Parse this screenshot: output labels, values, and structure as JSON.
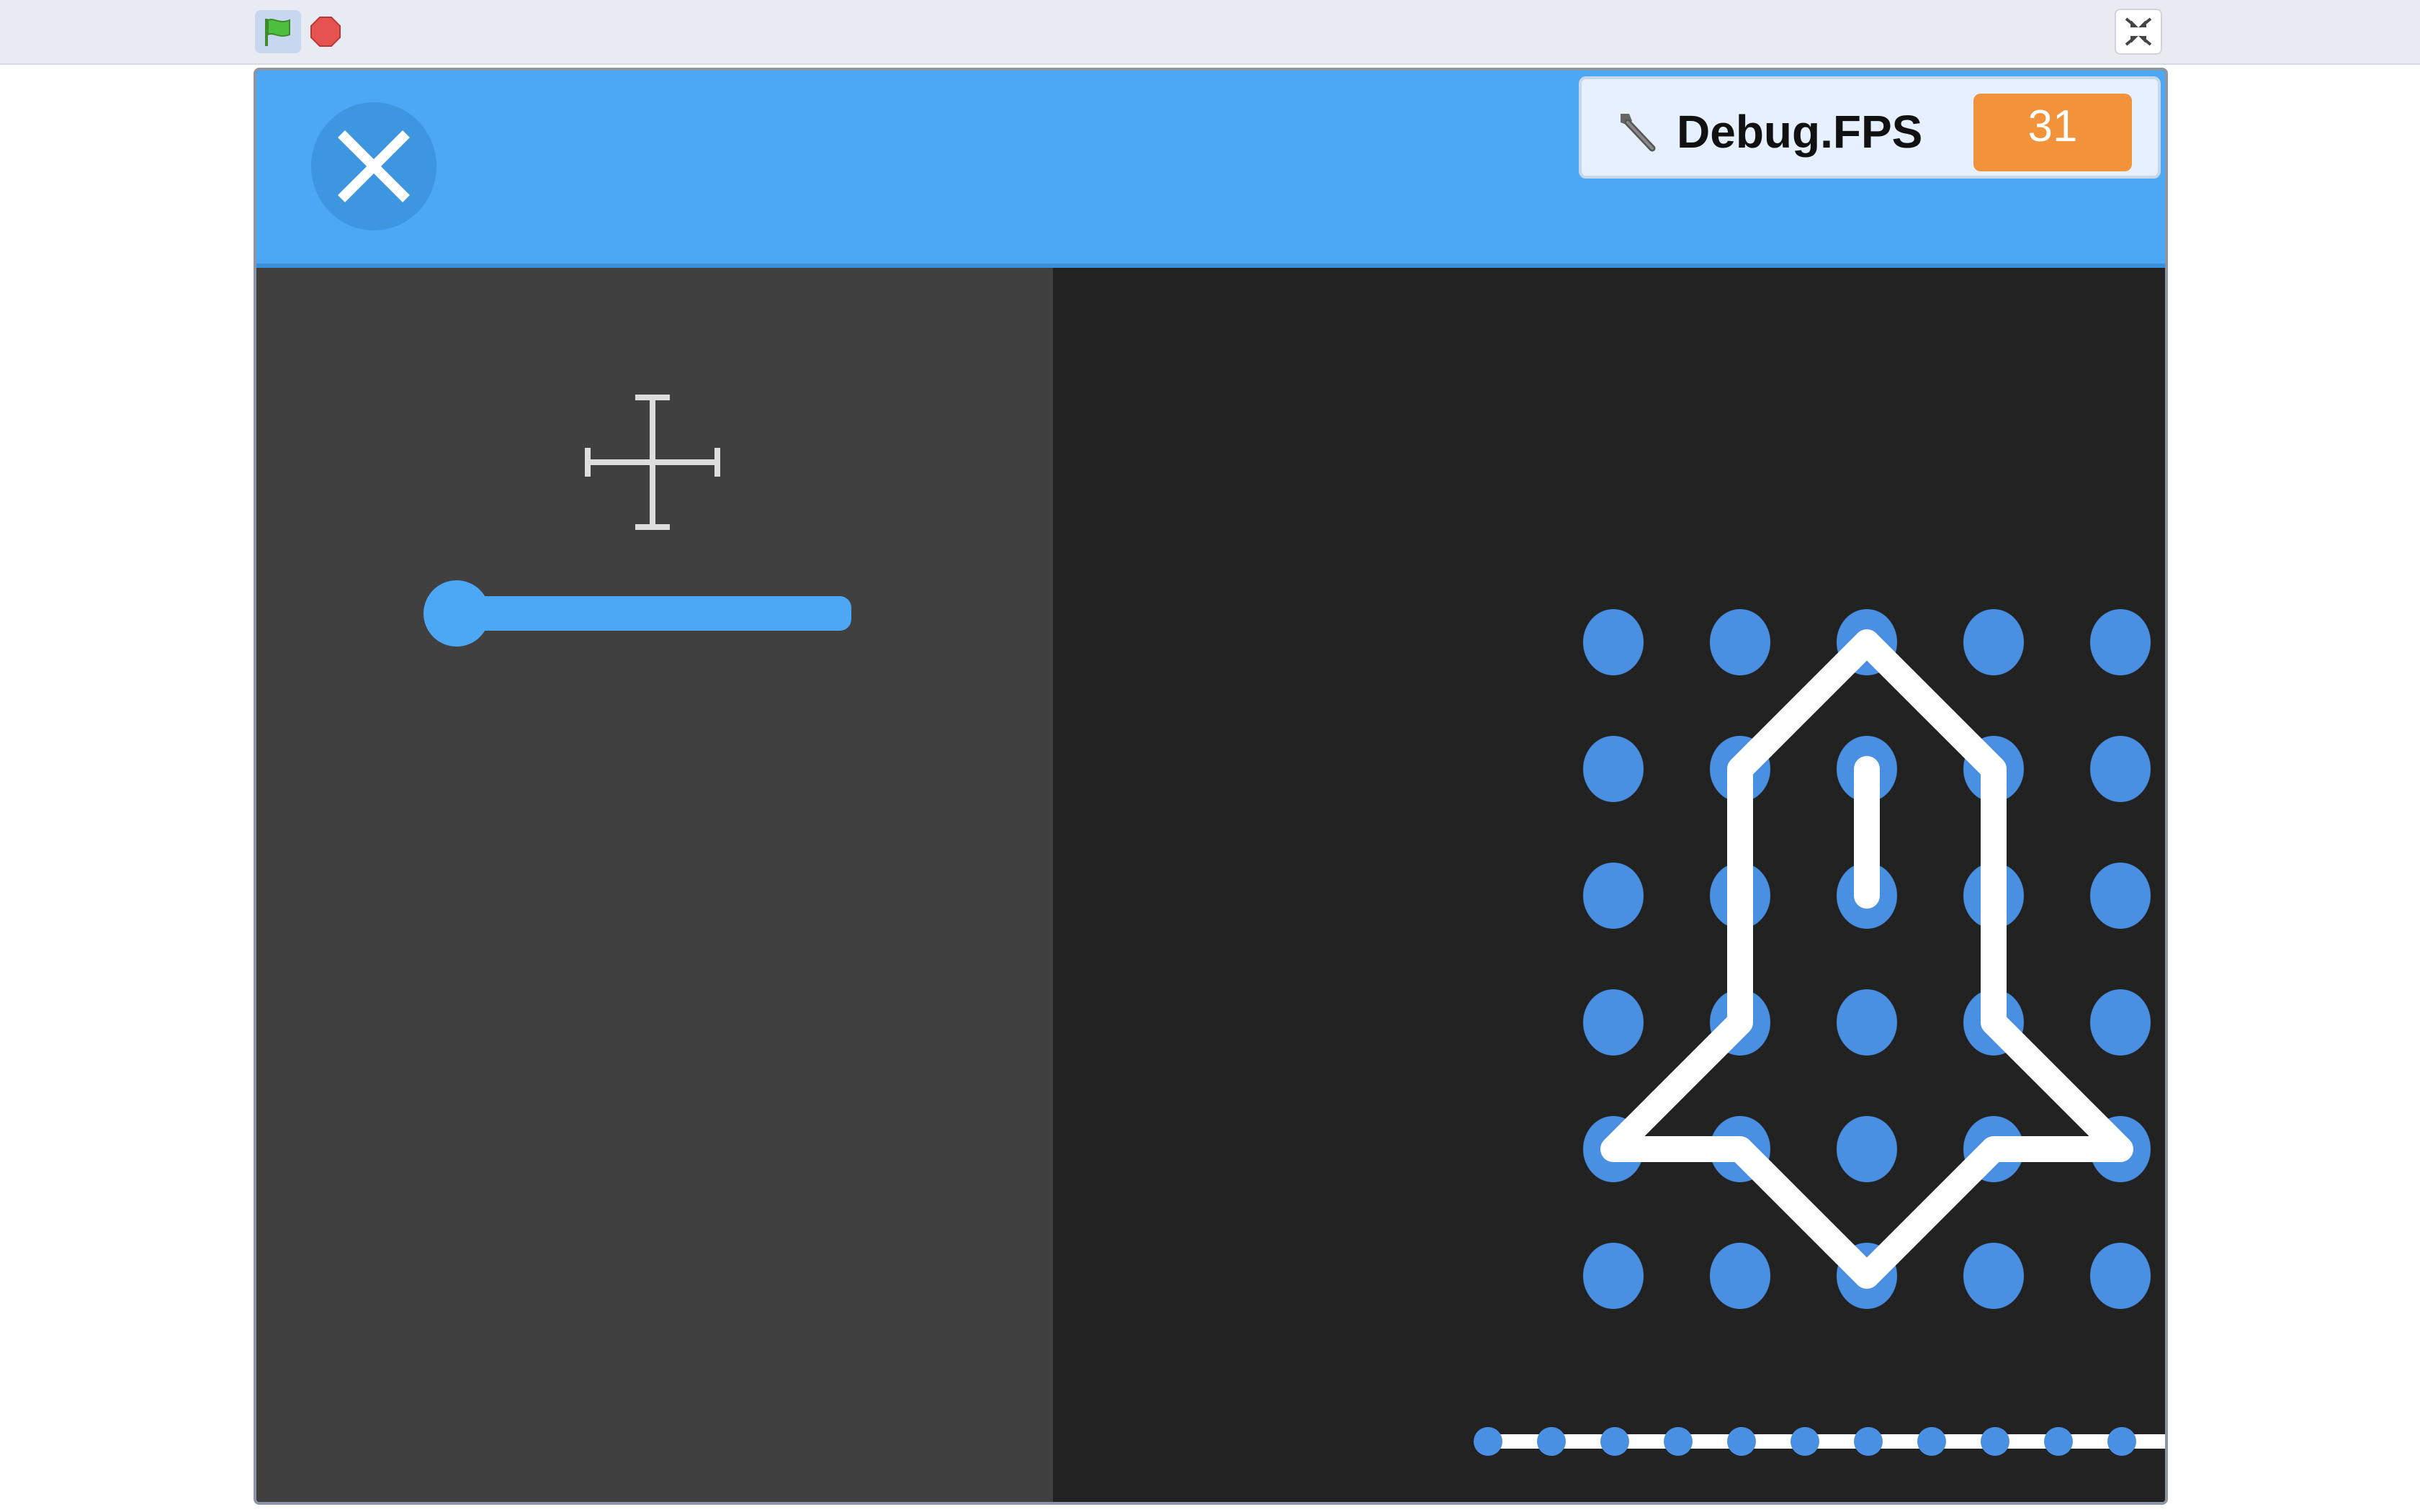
{
  "toolbar": {
    "green_flag": "green-flag-icon",
    "stop": "stop-icon",
    "fullscreen": "exit-fullscreen-icon"
  },
  "header": {
    "close": "close-icon"
  },
  "monitor": {
    "label": "Debug.FPS",
    "value": "31",
    "icon": "wrench-icon"
  },
  "editor": {
    "tool_icon": "move-icon",
    "zoom_slider_value": 0.0
  },
  "timeline": {
    "frame_count": 12,
    "current_frame": 12
  },
  "colors": {
    "header_blue": "#4ca8f5",
    "accent_blue": "#4a90e2",
    "monitor_orange": "#f2923a",
    "left_panel": "#404040",
    "canvas": "#222222"
  }
}
